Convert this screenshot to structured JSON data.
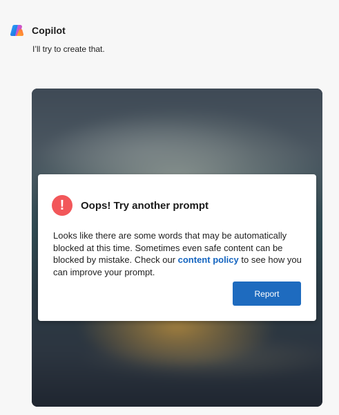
{
  "header": {
    "app_name": "Copilot",
    "logo_icon": "copilot-logo-icon"
  },
  "response": {
    "message": "I’ll try to create that."
  },
  "dialog": {
    "icon": "error-exclamation-icon",
    "title": "Oops! Try another prompt",
    "body_before_link": "Looks like there are some words that may be automatically blocked at this time. Sometimes even safe content can be blocked by mistake. Check our ",
    "link_text": "content policy",
    "body_after_link": " to see how you can improve your prompt.",
    "button_label": "Report"
  },
  "colors": {
    "background": "#f7f7f7",
    "error": "#f2575a",
    "link": "#1565c0",
    "button": "#1e6bbf"
  }
}
